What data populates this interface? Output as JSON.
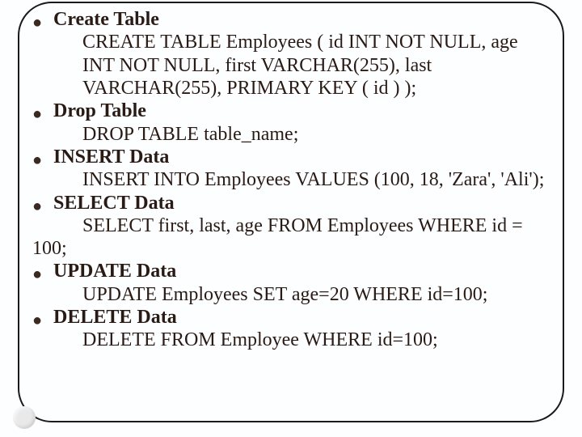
{
  "items": [
    {
      "heading": "Create Table",
      "body": "CREATE TABLE Employees ( id INT NOT NULL, age INT NOT NULL, first VARCHAR(255), last VARCHAR(255), PRIMARY KEY ( id ) );",
      "wrap": ""
    },
    {
      "heading": "Drop Table",
      "body": "DROP TABLE table_name;",
      "wrap": ""
    },
    {
      "heading": "INSERT Data",
      "body": "INSERT INTO Employees VALUES (100, 18, 'Zara', 'Ali');",
      "wrap": ""
    },
    {
      "heading": "SELECT Data",
      "body": "SELECT first, last, age  FROM Employees  WHERE id =",
      "wrap": "100;"
    },
    {
      "heading": "UPDATE Data",
      "body": "UPDATE Employees SET age=20 WHERE id=100;",
      "wrap": ""
    },
    {
      "heading": "DELETE Data",
      "body": "DELETE FROM Employee WHERE id=100;",
      "wrap": ""
    }
  ]
}
